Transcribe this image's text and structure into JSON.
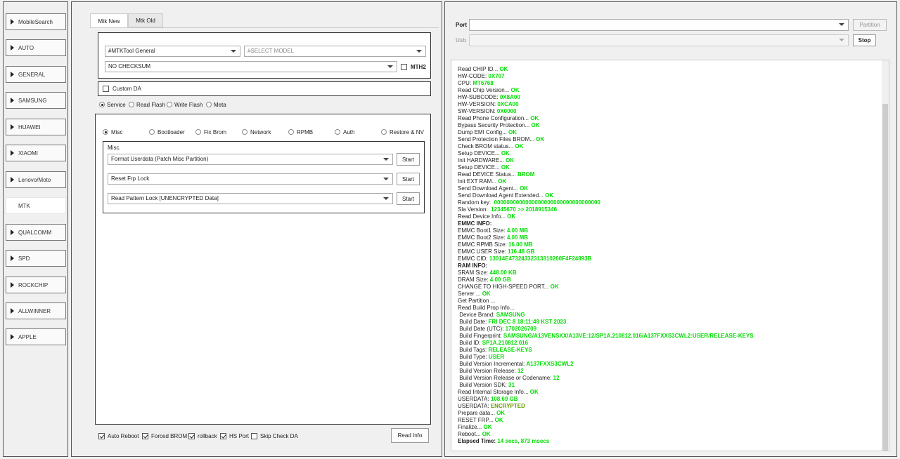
{
  "sidebar": {
    "items": [
      {
        "label": "MobileSearch",
        "arrow": true
      },
      {
        "label": "AUTO",
        "arrow": true
      },
      {
        "label": "GENERAL",
        "arrow": true
      },
      {
        "label": "SAMSUNG",
        "arrow": true
      },
      {
        "label": "HUAWEI",
        "arrow": true
      },
      {
        "label": "XIAOMI",
        "arrow": true
      },
      {
        "label": "Lenovo/Moto",
        "arrow": true
      },
      {
        "label": "MTK",
        "arrow": false,
        "active": true
      },
      {
        "label": "QUALCOMM",
        "arrow": true
      },
      {
        "label": "SPD",
        "arrow": true
      },
      {
        "label": "ROCKCHIP",
        "arrow": true
      },
      {
        "label": "ALLWINNER",
        "arrow": true
      },
      {
        "label": "APPLE",
        "arrow": true
      }
    ]
  },
  "tabs": [
    {
      "label": "Mtk New",
      "active": true
    },
    {
      "label": "Mtk Old",
      "active": false
    }
  ],
  "config": {
    "tool_select": "#MTKTool General",
    "model_select": "#SELECT MODEL",
    "checksum_select": "NO CHECKSUM",
    "mth2_label": "MTH2",
    "mth2_checked": false
  },
  "custom_da": {
    "label": "Custom DA",
    "checked": false
  },
  "modes": [
    {
      "label": "Service",
      "selected": true
    },
    {
      "label": "Read Flash",
      "selected": false
    },
    {
      "label": "Write Flash",
      "selected": false
    },
    {
      "label": "Meta",
      "selected": false
    }
  ],
  "service_tabs": [
    {
      "label": "Misc",
      "selected": true
    },
    {
      "label": "Bootloader",
      "selected": false
    },
    {
      "label": "Fix Brom",
      "selected": false
    },
    {
      "label": "Network",
      "selected": false
    },
    {
      "label": "RPMB",
      "selected": false
    },
    {
      "label": "Auth",
      "selected": false
    },
    {
      "label": "Restore & NV",
      "selected": false
    }
  ],
  "misc": {
    "title": "Misc.",
    "rows": [
      {
        "value": "Format Userdata (Patch Misc Partition)",
        "button": "Start"
      },
      {
        "value": "Reset Frp Lock",
        "button": "Start"
      },
      {
        "value": "Read Pattern Lock [UNENCRYPTED Data]",
        "button": "Start"
      }
    ]
  },
  "options": [
    {
      "label": "Auto Reboot",
      "checked": true
    },
    {
      "label": "Forced BROM",
      "checked": true
    },
    {
      "label": "rollback",
      "checked": true
    },
    {
      "label": "HS Port",
      "checked": true
    },
    {
      "label": "Skip Check DA",
      "checked": false
    }
  ],
  "read_info_button": "Read Info",
  "port": {
    "port_label": "Port",
    "port_value": "",
    "usb_label": "Usb",
    "usb_value": "",
    "partition_button": "Partition",
    "stop_button": "Stop"
  },
  "colors": {
    "ok_green": "#00dd00",
    "olive": "#669900"
  },
  "log": [
    {
      "t": "Read CHIP ID... ",
      "v": "OK"
    },
    {
      "t": "HW-CODE: ",
      "v": "0X707"
    },
    {
      "t": "CPU: ",
      "v": "MT6768"
    },
    {
      "t": "Read Chip Version... ",
      "v": "OK"
    },
    {
      "t": "HW-SUBCODE: ",
      "v": "0X8A00"
    },
    {
      "t": "HW-VERSION: ",
      "v": "0XCA00"
    },
    {
      "t": "SW-VERSION: ",
      "v": "0X0000"
    },
    {
      "t": "Read Phone Configuration... ",
      "v": "OK"
    },
    {
      "t": "Bypass Security Protection... ",
      "v": "OK"
    },
    {
      "t": "Dump EMI Config... ",
      "v": "OK"
    },
    {
      "t": "Send Protection Files BROM... ",
      "v": "OK"
    },
    {
      "t": "Check BROM status... ",
      "v": "OK"
    },
    {
      "t": "Setup DEVICE... ",
      "v": "OK"
    },
    {
      "t": "Init HARDWARE... ",
      "v": "OK"
    },
    {
      "t": "Setup DEVICE... ",
      "v": "OK"
    },
    {
      "t": "Read DEVICE Status... ",
      "v": "BROM"
    },
    {
      "t": "Init EXT RAM... ",
      "v": "OK"
    },
    {
      "t": "Send Download Agent... ",
      "v": "OK"
    },
    {
      "t": "Send Download Agent Extended... ",
      "v": "OK"
    },
    {
      "t": "Random key:  ",
      "v": "0000000000000000000000000000000000"
    },
    {
      "t": "Sla Version:  ",
      "v": "12345670  >> 2018915346"
    },
    {
      "t": "Read Device Info... ",
      "v": "OK"
    },
    {
      "t": "EMMC INFO:",
      "v": "",
      "bold": true
    },
    {
      "t": "EMMC Boot1 Size: ",
      "v": "4.00 MB"
    },
    {
      "t": "EMMC Boot2 Size: ",
      "v": "4.00 MB"
    },
    {
      "t": "EMMC RPMB Size: ",
      "v": "16.00 MB"
    },
    {
      "t": "EMMC USER Size: ",
      "v": "116.48 GB"
    },
    {
      "t": "EMMC CID: ",
      "v": "13014E47324332313310260F4F24893B"
    },
    {
      "t": "RAM INFO:",
      "v": "",
      "bold": true
    },
    {
      "t": "SRAM Size: ",
      "v": "448.00 KB"
    },
    {
      "t": "DRAM Size: ",
      "v": "4.00 GB"
    },
    {
      "t": "CHANGE TO HIGH-SPEED PORT... ",
      "v": "OK"
    },
    {
      "t": "Server ... ",
      "v": "OK"
    },
    {
      "t": "Get Partition ...",
      "v": ""
    },
    {
      "t": "Read Build Prop Info...",
      "v": ""
    },
    {
      "t": " Device Brand: ",
      "v": "SAMSUNG"
    },
    {
      "t": " Build Date: ",
      "v": "FRI DEC  8 18:11:49 KST 2023"
    },
    {
      "t": " Build Date (UTC): ",
      "v": "1702026709"
    },
    {
      "t": " Build Fingerprint: ",
      "v": "SAMSUNG/A13VENSXX/A13VE:12/SP1A.210812.016/A137FXXS3CWL2:USER/RELEASE-KEYS"
    },
    {
      "t": " Build ID: ",
      "v": "SP1A.210812.016"
    },
    {
      "t": " Build Tags: ",
      "v": "RELEASE-KEYS"
    },
    {
      "t": " Build Type: ",
      "v": "USER"
    },
    {
      "t": " Build Version Incremental: ",
      "v": "A137FXXS3CWL2"
    },
    {
      "t": " Build Version Release: ",
      "v": "12"
    },
    {
      "t": " Build Version Release or Codename: ",
      "v": "12"
    },
    {
      "t": " Build Version SDK: ",
      "v": "31"
    },
    {
      "t": "Read Internal Storage Info... ",
      "v": "OK"
    },
    {
      "t": "USERDATA: ",
      "v": "108.69 GB"
    },
    {
      "t": "USERDATA: ",
      "v": "ENCRYPTED",
      "olive": true
    },
    {
      "t": "Prepare data... ",
      "v": "OK"
    },
    {
      "t": "RESET FRP... ",
      "v": "OK"
    },
    {
      "t": "Finalize... ",
      "v": "OK"
    },
    {
      "t": "Reboot... ",
      "v": "OK"
    },
    {
      "t": "Elapsed Time: ",
      "v": "14 secs, 873 msecs",
      "bold": true
    }
  ]
}
